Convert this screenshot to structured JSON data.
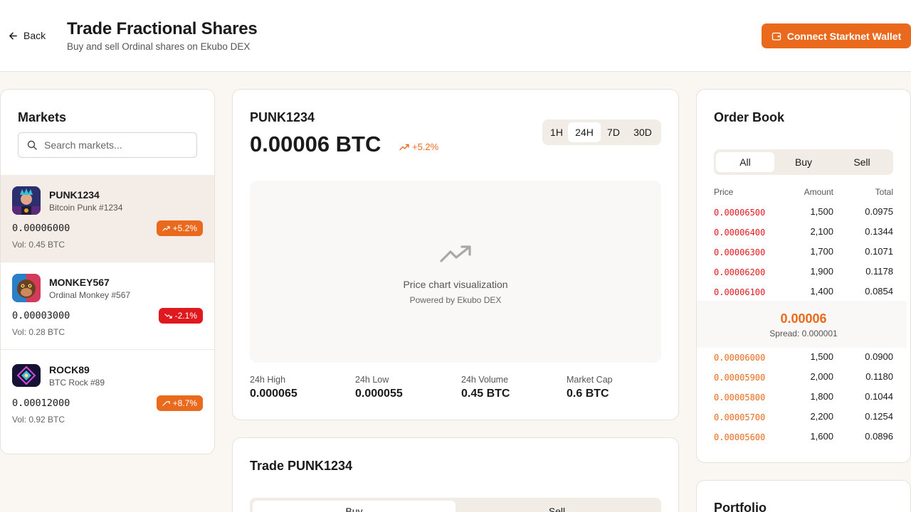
{
  "header": {
    "back_label": "Back",
    "title": "Trade Fractional Shares",
    "subtitle": "Buy and sell Ordinal shares on Ekubo DEX",
    "connect_label": "Connect Starknet Wallet"
  },
  "markets": {
    "title": "Markets",
    "search_placeholder": "Search markets...",
    "items": [
      {
        "symbol": "PUNK1234",
        "name": "Bitcoin Punk #1234",
        "price": "0.00006000",
        "volume": "Vol: 0.45 BTC",
        "change": "+5.2%",
        "direction": "up"
      },
      {
        "symbol": "MONKEY567",
        "name": "Ordinal Monkey #567",
        "price": "0.00003000",
        "volume": "Vol: 0.28 BTC",
        "change": "-2.1%",
        "direction": "down"
      },
      {
        "symbol": "ROCK89",
        "name": "BTC Rock #89",
        "price": "0.00012000",
        "volume": "Vol: 0.92 BTC",
        "change": "+8.7%",
        "direction": "up"
      }
    ]
  },
  "chart": {
    "symbol": "PUNK1234",
    "price": "0.00006 BTC",
    "change": "+5.2%",
    "timeframes": [
      "1H",
      "24H",
      "7D",
      "30D"
    ],
    "active_timeframe": "24H",
    "placeholder": "Price chart visualization",
    "powered_by": "Powered by Ekubo DEX",
    "stats": [
      {
        "label": "24h High",
        "value": "0.000065"
      },
      {
        "label": "24h Low",
        "value": "0.000055"
      },
      {
        "label": "24h Volume",
        "value": "0.45 BTC"
      },
      {
        "label": "Market Cap",
        "value": "0.6 BTC"
      }
    ]
  },
  "trade": {
    "title": "Trade PUNK1234",
    "tabs": [
      "Buy",
      "Sell"
    ]
  },
  "orderbook": {
    "title": "Order Book",
    "tabs": [
      "All",
      "Buy",
      "Sell"
    ],
    "columns": [
      "Price",
      "Amount",
      "Total"
    ],
    "asks": [
      {
        "price": "0.00006500",
        "amount": "1,500",
        "total": "0.0975"
      },
      {
        "price": "0.00006400",
        "amount": "2,100",
        "total": "0.1344"
      },
      {
        "price": "0.00006300",
        "amount": "1,700",
        "total": "0.1071"
      },
      {
        "price": "0.00006200",
        "amount": "1,900",
        "total": "0.1178"
      },
      {
        "price": "0.00006100",
        "amount": "1,400",
        "total": "0.0854"
      }
    ],
    "mid_price": "0.00006",
    "spread": "Spread: 0.000001",
    "bids": [
      {
        "price": "0.00006000",
        "amount": "1,500",
        "total": "0.0900"
      },
      {
        "price": "0.00005900",
        "amount": "2,000",
        "total": "0.1180"
      },
      {
        "price": "0.00005800",
        "amount": "1,800",
        "total": "0.1044"
      },
      {
        "price": "0.00005700",
        "amount": "2,200",
        "total": "0.1254"
      },
      {
        "price": "0.00005600",
        "amount": "1,600",
        "total": "0.0896"
      }
    ]
  },
  "portfolio": {
    "title": "Portfolio"
  },
  "colors": {
    "accent": "#e96a1c",
    "negative": "#e0191f",
    "background": "#faf7f3"
  }
}
